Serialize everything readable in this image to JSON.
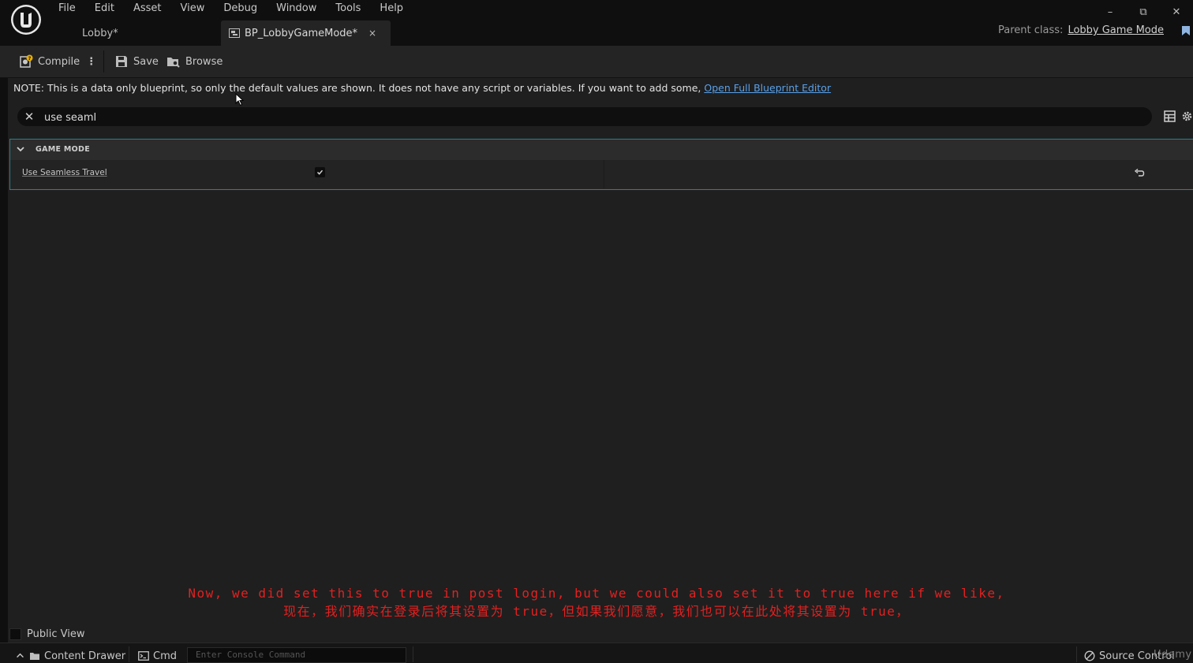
{
  "menu": {
    "items": [
      "File",
      "Edit",
      "Asset",
      "View",
      "Debug",
      "Window",
      "Tools",
      "Help"
    ]
  },
  "window": {
    "minimize": "–",
    "restore": "⧉",
    "close": "✕"
  },
  "tabs": {
    "lobby": "Lobby*",
    "blueprint": "BP_LobbyGameMode*",
    "close": "×"
  },
  "parent_class": {
    "label": "Parent class:",
    "value": "Lobby Game Mode"
  },
  "toolbar": {
    "compile": "Compile",
    "kebab": "⋮",
    "save": "Save",
    "browse": "Browse"
  },
  "note": {
    "text": "NOTE: This is a data only blueprint, so only the default values are shown.  It does not have any script or variables.  If you want to add some, ",
    "link": "Open Full Blueprint Editor"
  },
  "search": {
    "value": "use seaml",
    "clear": "✕"
  },
  "details": {
    "category": "GAME MODE",
    "property_label": "Use Seamless Travel",
    "property_checked": true
  },
  "subtitles": {
    "en": "Now, we did set this to true in post login, but we could also set it to true here if we like,",
    "zh": "现在，我们确实在登录后将其设置为 true，但如果我们愿意，我们也可以在此处将其设置为 true，"
  },
  "public_view": "Public View",
  "statusbar": {
    "content_drawer": "Content Drawer",
    "cmd": "Cmd",
    "console_placeholder": "Enter Console Command",
    "source_control": "Source Control"
  },
  "watermark": "Udemy",
  "colors": {
    "accent_link": "#5aa0e8",
    "subtitle_red": "#e32020",
    "category_border": "#2f7f86"
  }
}
